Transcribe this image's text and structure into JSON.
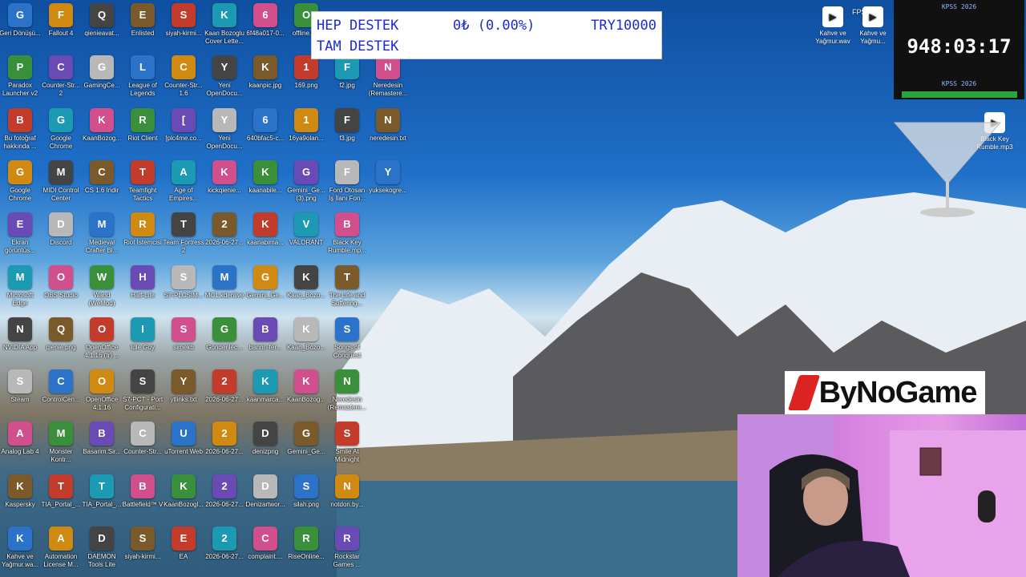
{
  "overlay": {
    "row1_left": "HEP DESTEK",
    "row1_mid": "0₺ (0.00%)",
    "row1_right": "TRY10000",
    "row2_left": "TAM DESTEK"
  },
  "timer": {
    "top_caption": "KPSS 2026",
    "time": "948:03:17",
    "bottom_caption": "KPSS 2026",
    "progress": 0.97
  },
  "fps_label": "FPS",
  "brand": "ByNoGame",
  "colors": {
    "accent_blue": "#1a2bd6",
    "progress_green": "#29a33b"
  },
  "desktop_columns": [
    [
      "Geri Dönüşü...",
      "Paradox Launcher v2",
      "Bu fotoğraf hakkında ...",
      "Google Chrome",
      "Ekran görüntüs...",
      "Microsoft Edge",
      "NVIDIA App",
      "Steam",
      "Analog Lab 4",
      "Kaspersky",
      "Kahve ve Yağmur.wa..."
    ],
    [
      "Fallout 4",
      "Counter-Str... 2",
      "Google Chrome",
      "MIDI Control Center",
      "Discord",
      "OBS Studio",
      "qienie.png",
      "ControlCen...",
      "Monster Kontr...",
      "TIA_Portal_...",
      "Automation License M..."
    ],
    [
      "qienieavat...",
      "GamingCe...",
      "KaanBozog...",
      "CS 1.6 Indir",
      "Medieval Crafter Bl...",
      "Wand (WeMod)",
      "OpenOffice 4.1.16 (tr) ...",
      "OpenOffice 4.1.16",
      "Basarim.Sir...",
      "TIA_Portal_...",
      "DAEMON Tools Lite"
    ],
    [
      "Enlisted",
      "League of Legends",
      "Riot Client",
      "Teamfight Tactics",
      "Riot İstemcisi",
      "Half-Life",
      "Idle Guy",
      "S7-PCT - Port Configurati...",
      "Counter-Str...",
      "Battlefield™ V",
      "siyah-kirmi..."
    ],
    [
      "siyah-kirmi...",
      "Counter-Str... 1.6",
      "[plc4me.co...",
      "Age of Empires...",
      "Team Fortress 2",
      "S7-PLCSIM...",
      "simekb",
      "ytlinks.txt",
      "uTorrent Web",
      "KaanBozogl...",
      "EA"
    ],
    [
      "Kaan Bozoglu Cover Lette...",
      "Yeni OpenDocu...",
      "Yeni OpenDocu...",
      "kickqienie...",
      "2026-06-27...",
      "MC1.kdenlive",
      "Gonderilec...",
      "2026-06-27...",
      "2026-06-27...",
      "2026-06-27...",
      "2026-06-27..."
    ],
    [
      "6f48a017-0...",
      "kaanpic.jpg",
      "640bfac5-c...",
      "kaanabile...",
      "kaanabima...",
      "Gemini_Ge...",
      "bannn-fer...",
      "kaanmarca...",
      "denizpng",
      "Denizartwor...",
      "complaint...."
    ],
    [
      "offline.p...",
      "169.png",
      "16ya9olan...",
      "Gemini_Ge... (3).png",
      "VALORANT",
      "Kaan_Bozo...",
      "Kaan_Bozo...",
      "KaanBozog...",
      "Gemini_Ge...",
      "silah.png",
      "RiseOnline..."
    ],
    [
      "",
      "f2.jpg",
      "f3.jpg",
      "Ford Otosan İş İlanı Fon...",
      "Black Key Rumble.mp...",
      "The Life and Suffering...",
      "Songs of Conquest",
      "Neredesin (Remastere...",
      "Smile At Midnight",
      "notdon.by...",
      "Rockstar Games ..."
    ],
    [
      "",
      "Neredesin (Remastere...",
      "neredesin.txt",
      "yuksekogre...",
      "",
      "",
      "",
      "",
      "",
      "",
      ""
    ]
  ],
  "right_icons": [
    {
      "label": "Kahve ve Yağmur.wav",
      "icon": "audio-icon"
    },
    {
      "label": "Kahve ve Yağmu...",
      "icon": "audio-icon"
    },
    {
      "label": "Black Key Rumble.mp3",
      "icon": "audio-icon"
    }
  ]
}
